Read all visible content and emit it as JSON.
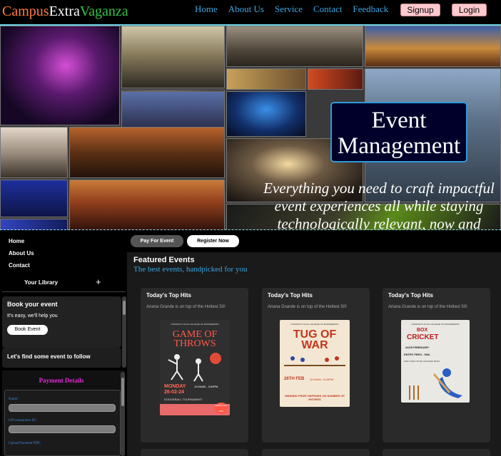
{
  "brand": {
    "part1": "Campus",
    "part2": "Extra",
    "part3": "Vaganza"
  },
  "nav": {
    "items": [
      "Home",
      "About Us",
      "Service",
      "Contact",
      "Feedback"
    ],
    "signup": "Signup",
    "login": "Login"
  },
  "hero": {
    "title_line1": "Event",
    "title_line2": "Management",
    "tagline": "Everything you need to craft impactful event experiences all while staying technologically relevant, now and"
  },
  "sidebar": {
    "nav": [
      "Home",
      "About Us",
      "Contact"
    ],
    "library_label": "Your Library",
    "library_add": "+",
    "book_title": "Book your event",
    "book_sub": "It's easy, we'll help you",
    "book_button": "Book Event",
    "follow_text": "Let's find some event to follow",
    "payment": {
      "title": "Payment Details",
      "name_label": "Name:",
      "upi_label": "UPI transaction ID:",
      "upload_label": "Upload Payment PDF:"
    }
  },
  "main": {
    "pay_button": "Pay For Event",
    "register_button": "Register Now",
    "featured_title": "Featured Events",
    "featured_sub": "The best events, handpicked for you",
    "cards": [
      {
        "title": "Today's Top Hits",
        "sub": "Ariana Grande is on top of the Hottest 50!"
      },
      {
        "title": "Today's Top Hits",
        "sub": "Ariana Grande is on top of the Hottest 50!"
      },
      {
        "title": "Today's Top Hits",
        "sub": "Ariana Grande is on top of the Hottest 50!"
      }
    ],
    "posters": {
      "p1": {
        "college": "LOKMANYA TILAK COLLEGE OF ENGINEERING",
        "title": "GAME OF THROWS",
        "date": "MONDAY 26-02-24",
        "time": "10:00AM - 3:00PM",
        "sport": "DODGEBALL TOURNAMENT",
        "badge": "ENTRY FEE 100/-"
      },
      "p2": {
        "college": "LOKMANYA TILAK COLLEGE OF ENGINEERING",
        "title1": "TUG OF",
        "title2": "WAR",
        "date": "26TH FEB",
        "time": "11:00AM - 6:00PM",
        "prize": "WINNING PRIZE DEPENDS ON NUMBER OF ENTRIES"
      },
      "p3": {
        "college": "LOKMANYA TILAK COLLEGE OF ENGINEERING",
        "title1": "BOX",
        "title2": "CRICKET",
        "date": "24/25 FEBRUARY",
        "entry": "ENTRY FEES : 500/-",
        "note": "ONLY FOR LTCOE COLLEGE TEAM"
      }
    }
  },
  "colors": {
    "brand_orange": "#ff7a3d",
    "brand_green": "#35c24b",
    "link_blue": "#3ba6e0",
    "payment_magenta": "#e12ad6",
    "auth_pink": "#ffc9cf"
  }
}
